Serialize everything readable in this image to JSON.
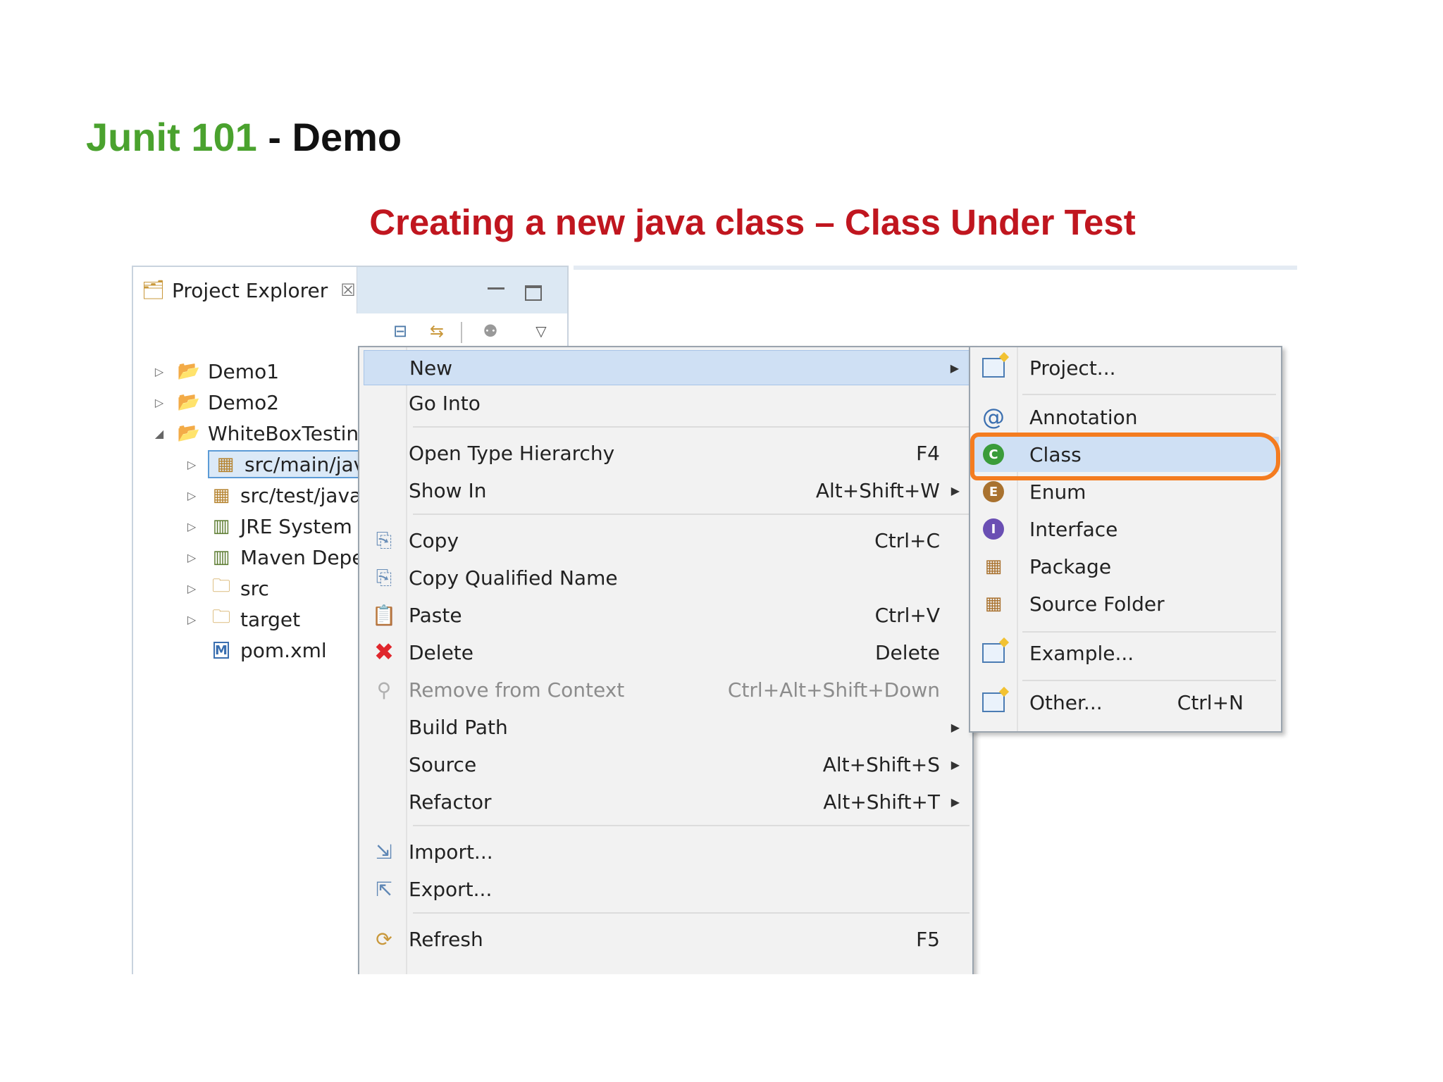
{
  "slide": {
    "title_green": "Junit 101",
    "title_rest": " - Demo",
    "subtitle": "Creating a new java class – Class Under Test"
  },
  "explorer": {
    "tab_label": "Project Explorer",
    "tab_close": "☒",
    "tree": [
      {
        "label": "Demo1",
        "icon": "maven-project-icon",
        "twisty": "▷"
      },
      {
        "label": "Demo2",
        "icon": "maven-project-icon",
        "twisty": "▷"
      },
      {
        "label": "WhiteBoxTesting",
        "icon": "maven-project-icon",
        "twisty": "◢"
      },
      {
        "label": "src/main/java",
        "icon": "package-folder-icon",
        "twisty": "▷"
      },
      {
        "label": "src/test/java",
        "icon": "package-folder-icon",
        "twisty": "▷"
      },
      {
        "label": "JRE System Library",
        "icon": "library-icon",
        "twisty": "▷"
      },
      {
        "label": "Maven Dependencies",
        "icon": "library-icon",
        "twisty": "▷"
      },
      {
        "label": "src",
        "icon": "folder-icon",
        "twisty": "▷"
      },
      {
        "label": "target",
        "icon": "folder-icon",
        "twisty": "▷"
      },
      {
        "label": "pom.xml",
        "icon": "pom-file-icon",
        "twisty": ""
      }
    ]
  },
  "context_menu": {
    "items": [
      {
        "label": "New",
        "shortcut": "",
        "submenu": true
      },
      {
        "label": "Go Into",
        "shortcut": ""
      },
      {
        "label": "Open Type Hierarchy",
        "shortcut": "F4"
      },
      {
        "label": "Show In",
        "shortcut": "Alt+Shift+W",
        "submenu": true
      },
      {
        "label": "Copy",
        "shortcut": "Ctrl+C"
      },
      {
        "label": "Copy Qualified Name",
        "shortcut": ""
      },
      {
        "label": "Paste",
        "shortcut": "Ctrl+V"
      },
      {
        "label": "Delete",
        "shortcut": "Delete"
      },
      {
        "label": "Remove from Context",
        "shortcut": "Ctrl+Alt+Shift+Down",
        "disabled": true
      },
      {
        "label": "Build Path",
        "shortcut": "",
        "submenu": true
      },
      {
        "label": "Source",
        "shortcut": "Alt+Shift+S",
        "submenu": true
      },
      {
        "label": "Refactor",
        "shortcut": "Alt+Shift+T",
        "submenu": true
      },
      {
        "label": "Import...",
        "shortcut": ""
      },
      {
        "label": "Export...",
        "shortcut": ""
      },
      {
        "label": "Refresh",
        "shortcut": "F5"
      }
    ]
  },
  "new_submenu": {
    "items": [
      {
        "label": "Project...",
        "shortcut": ""
      },
      {
        "label": "Annotation",
        "shortcut": ""
      },
      {
        "label": "Class",
        "shortcut": ""
      },
      {
        "label": "Enum",
        "shortcut": ""
      },
      {
        "label": "Interface",
        "shortcut": ""
      },
      {
        "label": "Package",
        "shortcut": ""
      },
      {
        "label": "Source Folder",
        "shortcut": ""
      },
      {
        "label": "Example...",
        "shortcut": ""
      },
      {
        "label": "Other...",
        "shortcut": "Ctrl+N"
      }
    ]
  },
  "colors": {
    "title_green": "#4aa22e",
    "subtitle_red": "#c0161f",
    "highlight_ring": "#f47c20",
    "menu_highlight": "#cfe0f4"
  }
}
